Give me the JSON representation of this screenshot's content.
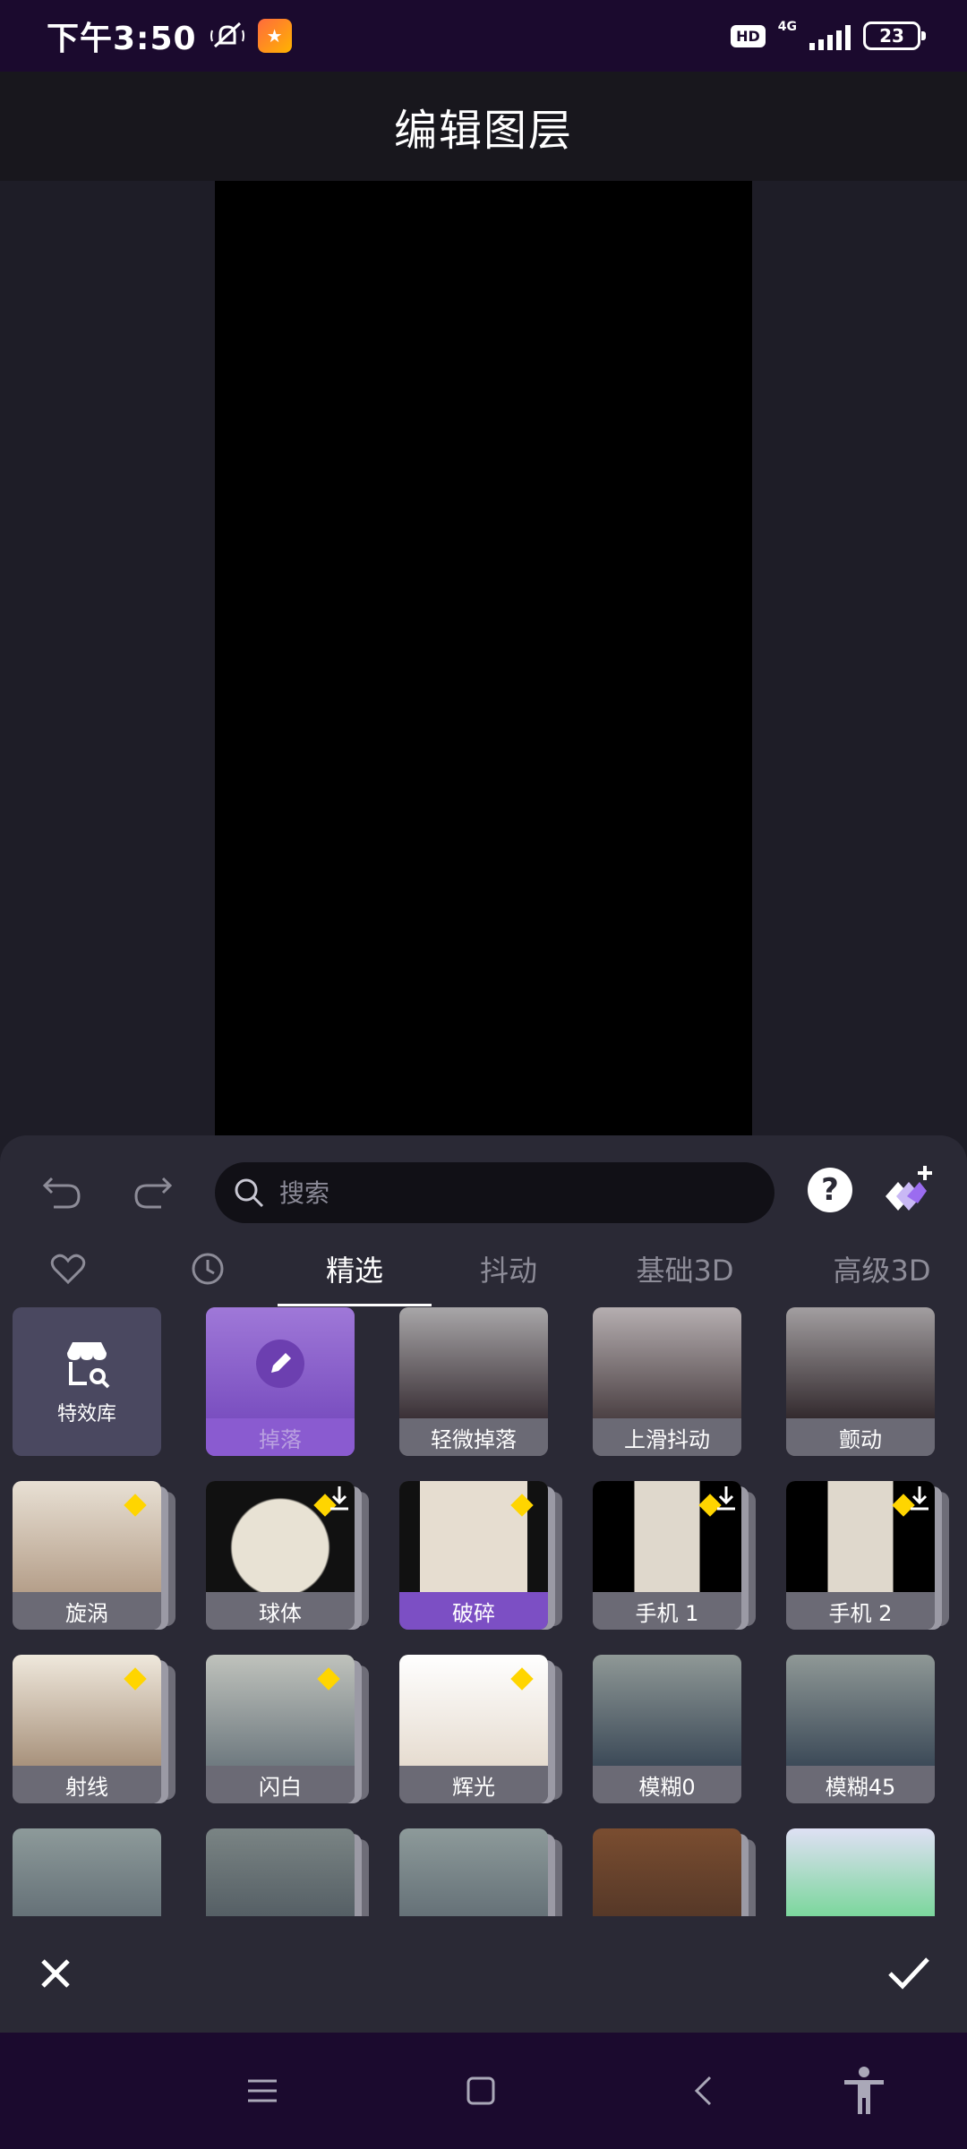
{
  "status": {
    "time": "下午3:50",
    "hd": "HD",
    "network": "4G",
    "battery": "23"
  },
  "header": {
    "title": "编辑图层"
  },
  "search": {
    "placeholder": "搜索"
  },
  "help": {
    "label": "?"
  },
  "tabs": [
    {
      "label": "精选",
      "active": true
    },
    {
      "label": "抖动"
    },
    {
      "label": "基础3D"
    },
    {
      "label": "高级3D"
    }
  ],
  "library": {
    "label": "特效库"
  },
  "effects": [
    {
      "label": "掉落",
      "state": "editing"
    },
    {
      "label": "轻微掉落"
    },
    {
      "label": "上滑抖动"
    },
    {
      "label": "颤动"
    },
    {
      "label": "旋涡",
      "premium": true
    },
    {
      "label": "球体",
      "premium": true,
      "download": true
    },
    {
      "label": "破碎",
      "premium": true,
      "selected": true
    },
    {
      "label": "手机 1",
      "premium": true,
      "download": true
    },
    {
      "label": "手机 2",
      "premium": true,
      "download": true
    },
    {
      "label": "射线",
      "premium": true
    },
    {
      "label": "闪白",
      "premium": true
    },
    {
      "label": "辉光",
      "premium": true
    },
    {
      "label": "模糊0"
    },
    {
      "label": "模糊45"
    }
  ],
  "colors": {
    "accent": "#7c4fc4",
    "premium": "#ffd500",
    "panel": "#2a2935",
    "status_bar": "#1b0a2e"
  }
}
